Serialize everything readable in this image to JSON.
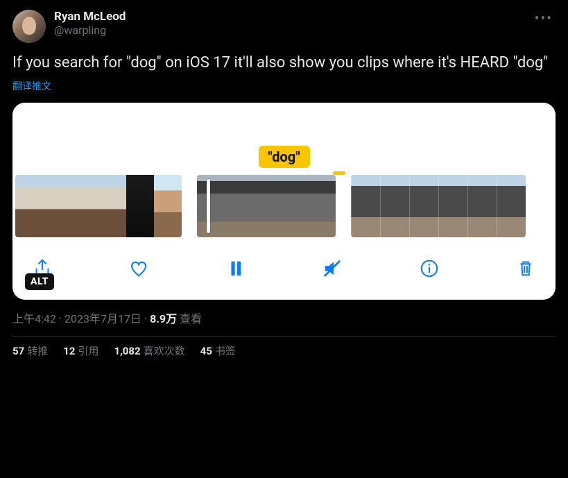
{
  "author": {
    "display_name": "Ryan McLeod",
    "handle": "@warpling"
  },
  "content": "If you search for \"dog\" on iOS 17 it'll also show you clips where it's HEARD \"dog\"",
  "translate_label": "翻译推文",
  "media": {
    "caption": "\"dog\"",
    "alt_badge": "ALT"
  },
  "meta": {
    "time": "上午4:42",
    "date": "2023年7月17日",
    "views_count": "8.9万",
    "views_label": "查看",
    "separator": " · "
  },
  "stats": {
    "retweets_count": "57",
    "retweets_label": "转推",
    "quotes_count": "12",
    "quotes_label": "引用",
    "likes_count": "1,082",
    "likes_label": "喜欢次数",
    "bookmarks_count": "45",
    "bookmarks_label": "书签"
  }
}
